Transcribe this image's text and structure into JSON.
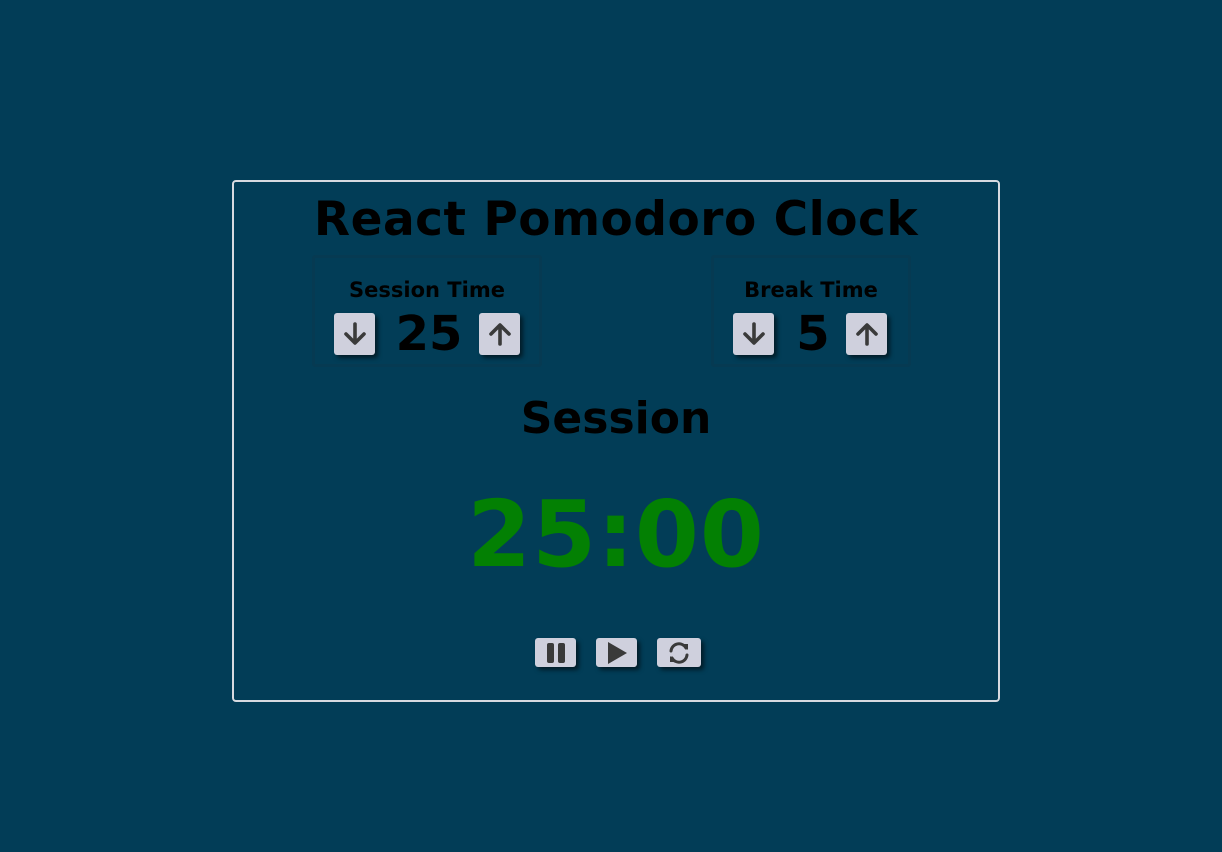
{
  "app": {
    "title": "React Pomodoro Clock"
  },
  "session_setting": {
    "label": "Session Time",
    "value": "25",
    "decrement_icon": "arrow-down-icon",
    "increment_icon": "arrow-up-icon"
  },
  "break_setting": {
    "label": "Break Time",
    "value": "5",
    "decrement_icon": "arrow-down-icon",
    "increment_icon": "arrow-up-icon"
  },
  "timer": {
    "phase": "Session",
    "display": "25:00"
  },
  "controls": {
    "pause_icon": "pause-icon",
    "play_icon": "play-icon",
    "reset_icon": "refresh-icon"
  },
  "colors": {
    "background": "#023d57",
    "timer_text": "#038003",
    "button_face": "#cfd0dd",
    "panel_border": "#d7dae0"
  }
}
